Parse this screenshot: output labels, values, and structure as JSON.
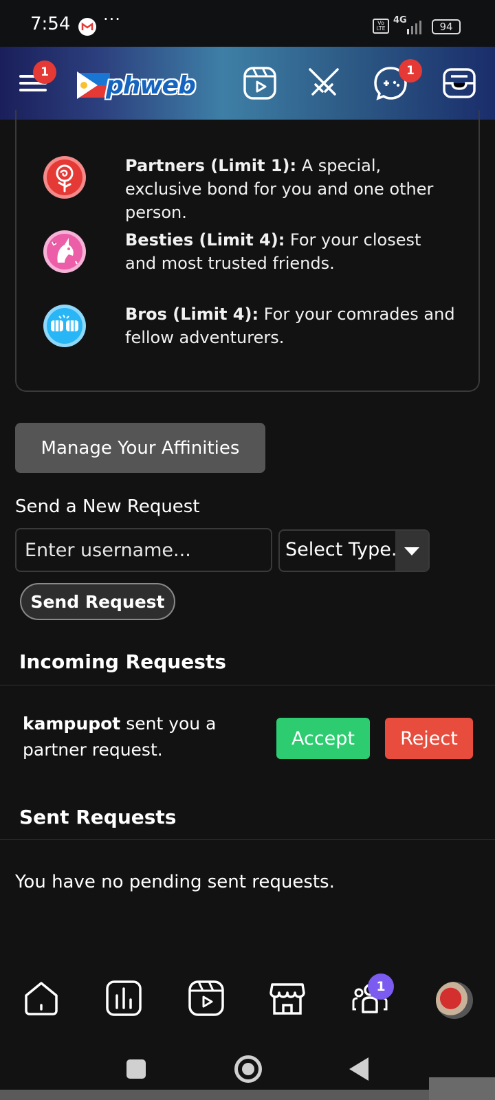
{
  "status_bar": {
    "time": "7:54",
    "more": "···",
    "network": "4G",
    "volte": "Vo LTE",
    "battery": "94"
  },
  "header": {
    "logo_text": "phweb",
    "menu_badge": "1",
    "chat_badge": "1",
    "icons": [
      "menu-icon",
      "reels-icon",
      "battle-icon",
      "gamepad-chat-icon",
      "inbox-icon"
    ]
  },
  "affinities": {
    "items": [
      {
        "name": "Partners (Limit 1):",
        "desc": " A special, exclusive bond for you and one other person.",
        "icon": "rose-icon",
        "color": "#e53935"
      },
      {
        "name": "Besties (Limit 4):",
        "desc": " For your closest and most trusted friends.",
        "icon": "unicorn-icon",
        "color": "#ec5fa8"
      },
      {
        "name": "Bros (Limit 4):",
        "desc": " For your comrades and fellow adventurers.",
        "icon": "fist-bump-icon",
        "color": "#29b6f6"
      }
    ],
    "manage_button": "Manage Your Affinities"
  },
  "send_request": {
    "label": "Send a New Request",
    "username_placeholder": "Enter username...",
    "type_select": "Select Type.",
    "button": "Send Request"
  },
  "incoming": {
    "title": "Incoming Requests",
    "request_user": "kampupot",
    "request_text": " sent you a partner request.",
    "accept": "Accept",
    "reject": "Reject"
  },
  "sent": {
    "title": "Sent Requests",
    "empty": "You have no pending sent requests."
  },
  "bottom_nav": {
    "items": [
      "home-icon",
      "stats-icon",
      "reels-icon",
      "store-icon",
      "affinity-icon",
      "avatar"
    ],
    "affinity_badge": "1"
  }
}
